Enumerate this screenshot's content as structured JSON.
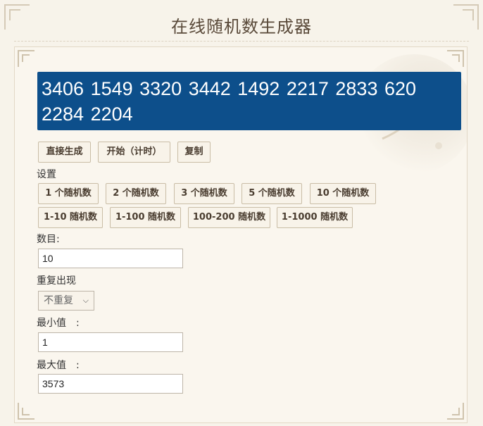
{
  "page": {
    "title": "在线随机数生成器"
  },
  "result": {
    "text": "3406 1549 3320 3442 1492 2217 2833 620 2284 2204"
  },
  "actions": {
    "generate": "直接生成",
    "start_timer": "开始（计时）",
    "copy": "复制"
  },
  "settings": {
    "heading": "设置",
    "presets": [
      "1 个随机数",
      "2 个随机数",
      "3 个随机数",
      "5 个随机数",
      "10 个随机数"
    ],
    "ranges": [
      "1-10 随机数",
      "1-100 随机数",
      "100-200 随机数",
      "1-1000 随机数"
    ]
  },
  "form": {
    "count_label": "数目:",
    "count_value": "10",
    "repeat_label": "重复出现",
    "repeat_value": "不重复",
    "min_label": "最小值　:",
    "min_value": "1",
    "max_label": "最大值　:",
    "max_value": "3573"
  }
}
